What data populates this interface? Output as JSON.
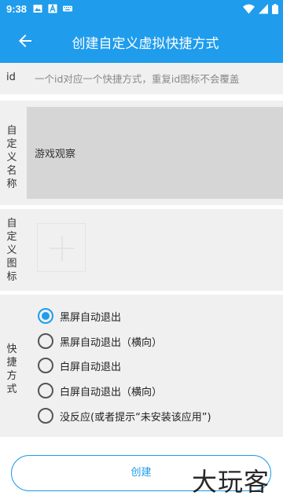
{
  "status_bar": {
    "time": "9:38",
    "icons": [
      "image-icon",
      "text-a-icon",
      "keyboard-icon"
    ],
    "right_icons": [
      "wifi-icon",
      "signal-icon",
      "battery-icon"
    ]
  },
  "app_bar": {
    "title": "创建自定义虚拟快捷方式",
    "back_icon": "arrow-back-icon",
    "background": "#1f9cec"
  },
  "id_field": {
    "label": "id",
    "placeholder": "一个id对应一个快捷方式，重复id图标不会覆盖",
    "value": ""
  },
  "name_field": {
    "label": "自定义名称",
    "value": "游戏观察"
  },
  "icon_field": {
    "label": "自定义图标",
    "add_icon": "plus-icon"
  },
  "method_field": {
    "label": "快捷方式",
    "options": [
      {
        "label": "黑屏自动退出",
        "checked": true
      },
      {
        "label": "黑屏自动退出（横向）",
        "checked": false
      },
      {
        "label": "白屏自动退出",
        "checked": false
      },
      {
        "label": "白屏自动退出（横向）",
        "checked": false
      },
      {
        "label": "没反应(或者提示“未安装该应用”)",
        "checked": false
      }
    ]
  },
  "create_button": {
    "label": "创建"
  },
  "watermark": {
    "text": "大玩客"
  },
  "colors": {
    "accent": "#1f9cec",
    "section_bg": "#f0f0f0",
    "input_bg": "#d6d6d6"
  }
}
